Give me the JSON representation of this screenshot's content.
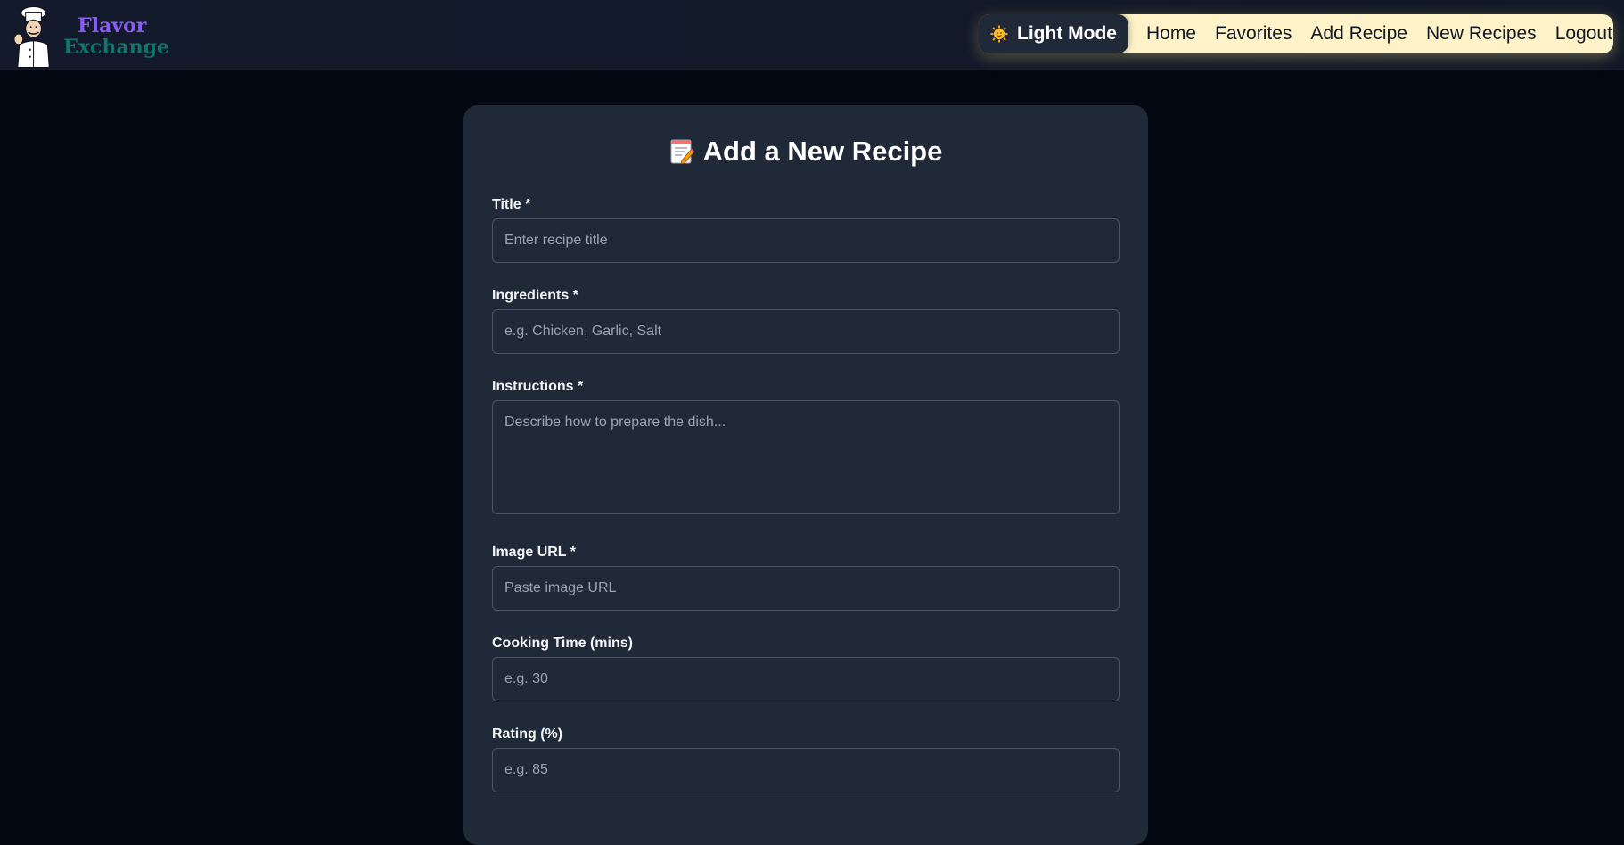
{
  "brand": {
    "line1": "Flavor",
    "line2": "Exchange",
    "colors": {
      "line1": "#8b5cf6",
      "line2": "#0f766e"
    }
  },
  "nav": {
    "mode_toggle": {
      "icon": "sun-icon",
      "label": "Light Mode"
    },
    "links": [
      "Home",
      "Favorites",
      "Add Recipe",
      "New Recipes",
      "Logout"
    ],
    "accent": "#fdf2c8"
  },
  "form": {
    "title_icon": "memo-icon",
    "title": "Add a New Recipe",
    "fields": [
      {
        "label": "Title *",
        "placeholder": "Enter recipe title"
      },
      {
        "label": "Ingredients *",
        "placeholder": "e.g. Chicken, Garlic, Salt"
      },
      {
        "label": "Instructions *",
        "placeholder": "Describe how to prepare the dish..."
      },
      {
        "label": "Image URL *",
        "placeholder": "Paste image URL"
      },
      {
        "label": "Cooking Time (mins)",
        "placeholder": "e.g. 30"
      },
      {
        "label": "Rating (%)",
        "placeholder": "e.g. 85"
      }
    ]
  }
}
